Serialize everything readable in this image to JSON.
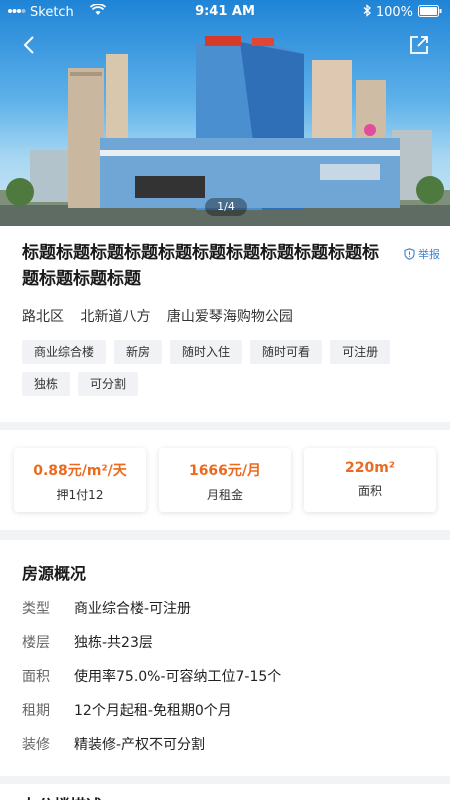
{
  "status_bar": {
    "carrier": "Sketch",
    "time": "9:41 AM",
    "battery": "100%"
  },
  "hero": {
    "pager": "1/4",
    "icons": {
      "back": "back-arrow-icon",
      "share": "share-icon"
    }
  },
  "listing": {
    "title": "标题标题标题标题标题标题标题标题标题标题标题标题标题标题",
    "report_label": "举报",
    "address": [
      "路北区",
      "北新道八方",
      "唐山爱琴海购物公园"
    ],
    "tags": [
      "商业综合楼",
      "新房",
      "随时入住",
      "随时可看",
      "可注册",
      "独栋",
      "可分割"
    ]
  },
  "stats": [
    {
      "value": "0.88元/m²/天",
      "label": "押1付12"
    },
    {
      "value": "1666元/月",
      "label": "月租金"
    },
    {
      "value": "220m²",
      "label": "面积"
    }
  ],
  "overview": {
    "title": "房源概况",
    "rows": [
      {
        "key": "类型",
        "value": "商业综合楼-可注册"
      },
      {
        "key": "楼层",
        "value": "独栋-共23层"
      },
      {
        "key": "面积",
        "value": "使用率75.0%-可容纳工位7-15个"
      },
      {
        "key": "租期",
        "value": "12个月起租-免租期0个月"
      },
      {
        "key": "装修",
        "value": "精装修-产权不可分割"
      }
    ]
  },
  "office_section": {
    "title": "办公楼描述"
  },
  "colors": {
    "accent": "#ea6a1f",
    "link": "#3c7fd6"
  }
}
